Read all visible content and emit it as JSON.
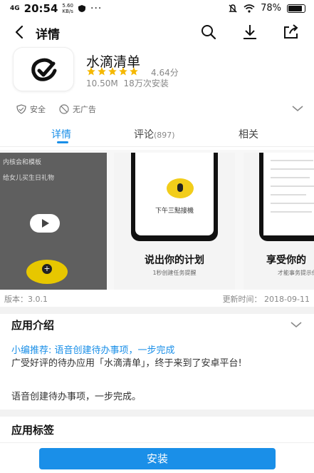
{
  "status_bar": {
    "signal": "4G",
    "time": "20:54",
    "net_speed_value": "5.60",
    "net_speed_unit": "KB/s",
    "more_dots": "···",
    "battery": "78%"
  },
  "app_bar": {
    "title": "详情"
  },
  "app": {
    "name": "水滴清单",
    "stars": 5,
    "rating": "4.64分",
    "size": "10.50M",
    "installs": "18万次安装"
  },
  "badges": {
    "safe": "安全",
    "no_ads": "无广告"
  },
  "tabs": [
    {
      "label": "详情",
      "count": ""
    },
    {
      "label": "评论",
      "count": "(897)"
    },
    {
      "label": "相关",
      "count": ""
    }
  ],
  "screenshots": {
    "shot1_line1": "内核会和模板",
    "shot1_line2": "给女儿买生日礼物",
    "shot2_caption": "下午三點接機",
    "shot2_heading": "说出你的计划",
    "shot2_sub": "1秒创建任务提醒",
    "shot3_heading": "享受你的",
    "shot3_sub": "才能事务提示你"
  },
  "version": {
    "label": "版本：3.0.1",
    "updated": "更新时间： 2018-09-11"
  },
  "intro": {
    "title": "应用介绍",
    "editor_pick": "小编推荐: 语音创建待办事项，一步完成",
    "desc1": "广受好评的待办应用「水滴清单」，终于来到了安卓平台!",
    "desc2": "语音创建待办事项，一步完成。"
  },
  "tags": {
    "title": "应用标签"
  },
  "install_button": "安装",
  "colors": {
    "accent": "#1a8fe8",
    "star": "#f5b800",
    "brand_yellow": "#f2cd1a"
  }
}
